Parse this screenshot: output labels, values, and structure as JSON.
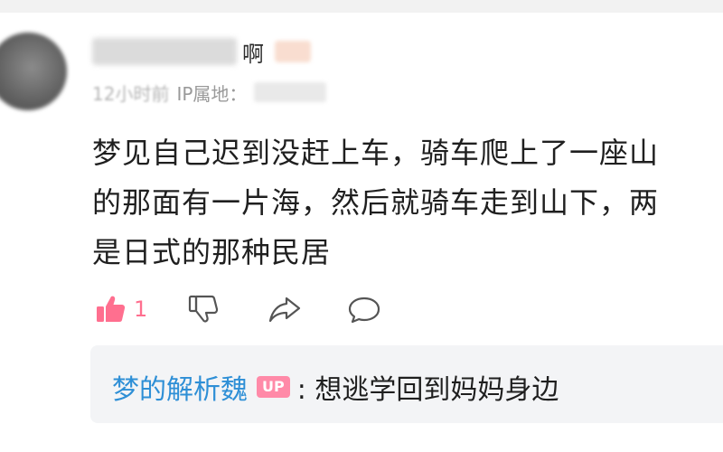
{
  "comment": {
    "author_visible_suffix": "啊",
    "meta": {
      "time_blurred": "12小时前",
      "ip_label": "IP属地："
    },
    "lines": [
      "梦见自己迟到没赶上车，骑车爬上了一座山",
      "的那面有一片海，然后就骑车走到山下，两",
      "是日式的那种民居"
    ],
    "actions": {
      "like_icon": "thumbs-up-icon",
      "like_count": "1",
      "dislike_icon": "thumbs-down-icon",
      "share_icon": "share-icon",
      "reply_icon": "comment-bubble-icon"
    },
    "reply": {
      "author": "梦的解析魏",
      "badge": "UP",
      "text": ":  想逃学回到妈妈身边"
    }
  },
  "colors": {
    "like_accent": "#ff6f8f",
    "reply_author": "#2e8fd6",
    "up_badge_bg": "#ff8aa8",
    "reply_bg": "#f3f4f6",
    "meta_text": "#9a9a9a"
  }
}
